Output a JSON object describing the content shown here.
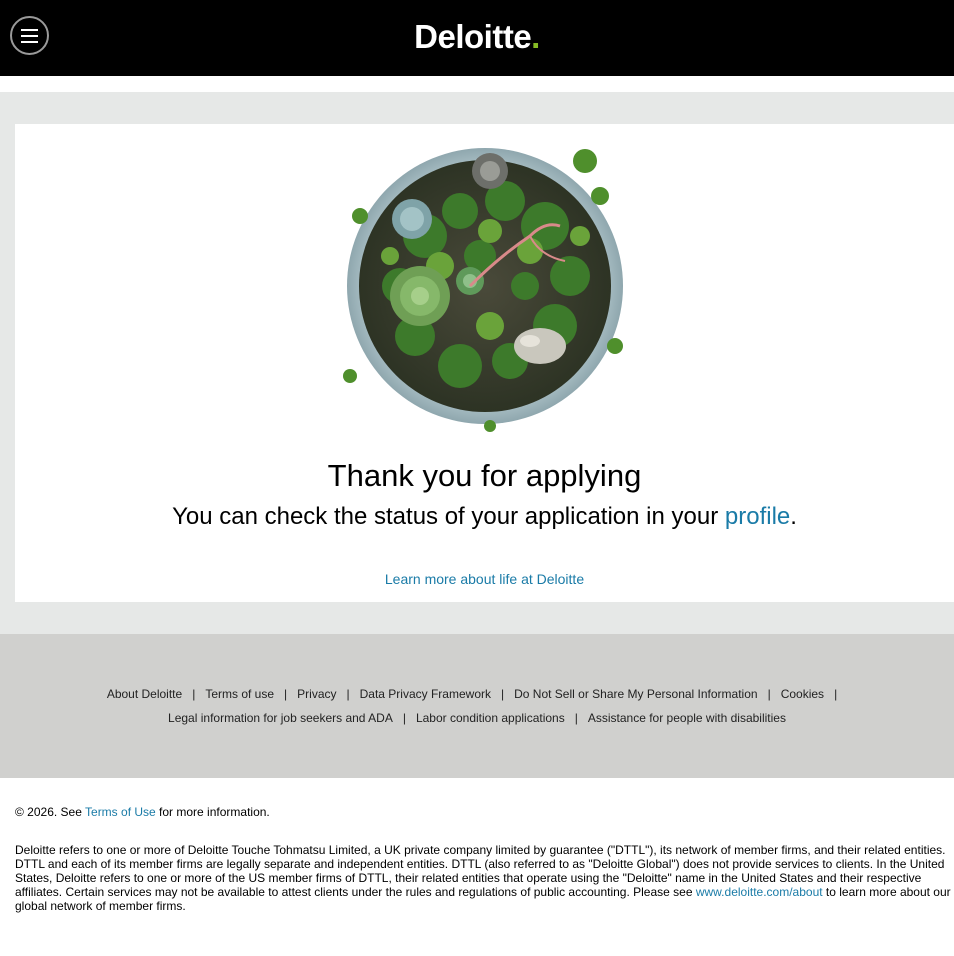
{
  "header": {
    "menu_icon": "hamburger-menu-icon",
    "logo_text": "Deloitte",
    "logo_dot": ".",
    "logo_dot_color": "#86bc25"
  },
  "main": {
    "image_icon": "succulent-planter-image",
    "title": "Thank you for applying",
    "status_prefix": "You can check the status of your application in your ",
    "status_link": "profile",
    "status_suffix": ".",
    "learn_more": "Learn more about life at Deloitte"
  },
  "footer": {
    "row1": [
      "About Deloitte",
      "Terms of use",
      "Privacy",
      "Data Privacy Framework",
      "Do Not Sell or Share My Personal Information",
      "Cookies"
    ],
    "row2": [
      "Legal information for job seekers and ADA",
      "Labor condition applications",
      "Assistance for people with disabilities"
    ],
    "separator": "|"
  },
  "copyright": {
    "prefix": "© 2026. See ",
    "link": "Terms of Use",
    "suffix": " for more information."
  },
  "legal": {
    "text": "Deloitte refers to one or more of Deloitte Touche Tohmatsu Limited, a UK private company limited by guarantee (\"DTTL\"), its network of member firms, and their related entities. DTTL and each of its member firms are legally separate and independent entities. DTTL (also referred to as \"Deloitte Global\") does not provide services to clients. In the United States, Deloitte refers to one or more of the US member firms of DTTL, their related entities that operate using the \"Deloitte\" name in the United States and their respective affiliates. Certain services may not be available to attest clients under the rules and regulations of public accounting. Please see ",
    "link": "www.deloitte.com/about",
    "suffix": " to learn more about our global network of member firms."
  },
  "colors": {
    "link": "#1a7ba7",
    "header_bg": "#000000",
    "band_bg": "#e6e8e7",
    "footer_bg": "#d0d0ce"
  }
}
